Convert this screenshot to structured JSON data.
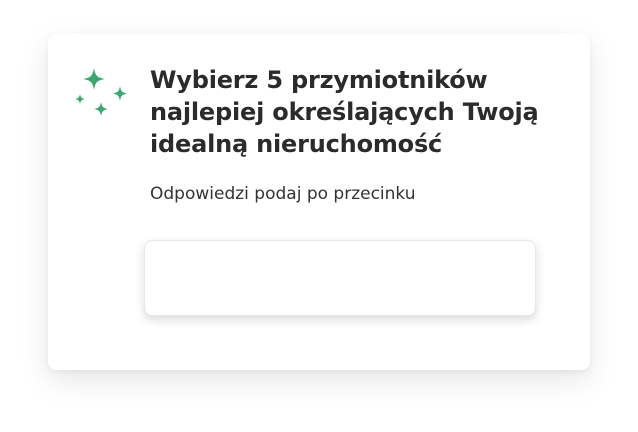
{
  "question": {
    "title": "Wybierz 5 przymiotników najlepiej określających Twoją idealną nieruchomość",
    "hint": "Odpowiedzi podaj po przecinku"
  },
  "answer": {
    "value": "",
    "placeholder": ""
  },
  "icon": {
    "name": "sparkles-icon",
    "color": "#3aa76d"
  }
}
